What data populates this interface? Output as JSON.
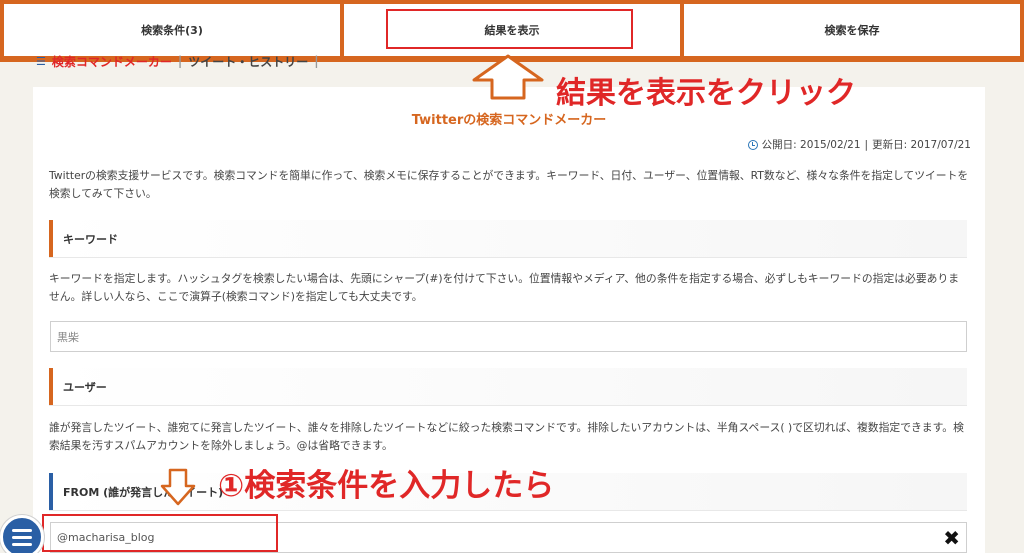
{
  "toolbar": {
    "search_conditions_label": "検索条件(3)",
    "show_results_label": "結果を表示",
    "save_search_label": "検索を保存"
  },
  "breadcrumb": {
    "active": "検索コマンドメーカー",
    "other": "ツイート・ヒストリー"
  },
  "page": {
    "title": "Twitterの検索コマンドメーカー",
    "published": "公開日: 2015/02/21",
    "updated": "更新日: 2017/07/21",
    "date_separator": "|",
    "intro": "Twitterの検索支援サービスです。検索コマンドを簡単に作って、検索メモに保存することができます。キーワード、日付、ユーザー、位置情報、RT数など、様々な条件を指定してツイートを検索してみて下さい。"
  },
  "keyword_section": {
    "heading": "キーワード",
    "description": "キーワードを指定します。ハッシュタグを検索したい場合は、先頭にシャープ(#)を付けて下さい。位置情報やメディア、他の条件を指定する場合、必ずしもキーワードの指定は必要ありません。詳しい人なら、ここで演算子(検索コマンド)を指定しても大丈夫です。",
    "placeholder": "黒柴"
  },
  "user_section": {
    "heading": "ユーザー",
    "description": "誰が発言したツイート、誰宛てに発言したツイート、誰々を排除したツイートなどに絞った検索コマンドです。排除したいアカウントは、半角スペース( )で区切れば、複数指定できます。検索結果を汚すスパムアカウントを除外しましょう。@は省略できます。"
  },
  "from_section": {
    "heading": "FROM (誰が発言したツイート)",
    "value": "@macharisa_blog"
  },
  "annotations": {
    "click_results": "結果を表示をクリック",
    "enter_conditions": "①検索条件を入力したら"
  },
  "colors": {
    "accent_orange": "#d6661f",
    "annotation_red": "#e02727",
    "blue": "#2a5fa5"
  },
  "icons": [
    "clock-icon",
    "close-icon",
    "menu-icon",
    "up-arrow-icon",
    "down-arrow-icon",
    "list-icon"
  ]
}
